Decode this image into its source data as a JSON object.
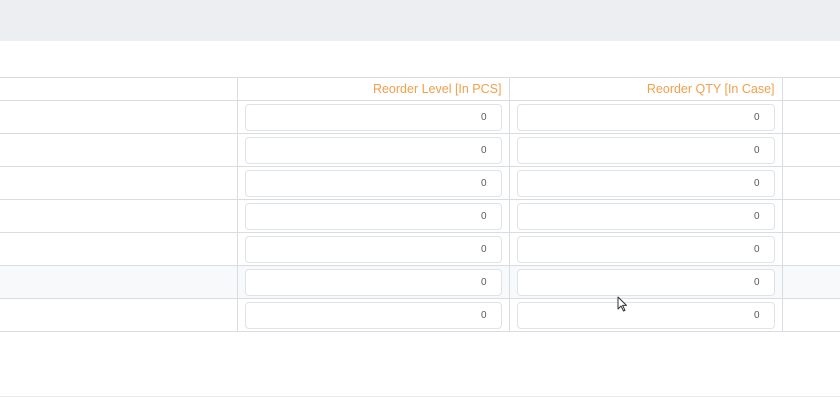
{
  "table": {
    "columns": [
      {
        "label": ""
      },
      {
        "label": "Reorder Level [In PCS]"
      },
      {
        "label": "Reorder QTY [In Case]"
      },
      {
        "label": ""
      }
    ],
    "rows": [
      {
        "reorder_level": "0",
        "reorder_qty": "0"
      },
      {
        "reorder_level": "0",
        "reorder_qty": "0"
      },
      {
        "reorder_level": "0",
        "reorder_qty": "0"
      },
      {
        "reorder_level": "0",
        "reorder_qty": "0"
      },
      {
        "reorder_level": "0",
        "reorder_qty": "0"
      },
      {
        "reorder_level": "0",
        "reorder_qty": "0"
      },
      {
        "reorder_level": "0",
        "reorder_qty": "0"
      }
    ]
  },
  "colors": {
    "header_text": "#f0a04b",
    "border": "#d9dde2",
    "top_band": "#eceef1",
    "highlight_row": "#f7f9fb"
  },
  "icons": {
    "cursor": "mouse-pointer-icon"
  }
}
